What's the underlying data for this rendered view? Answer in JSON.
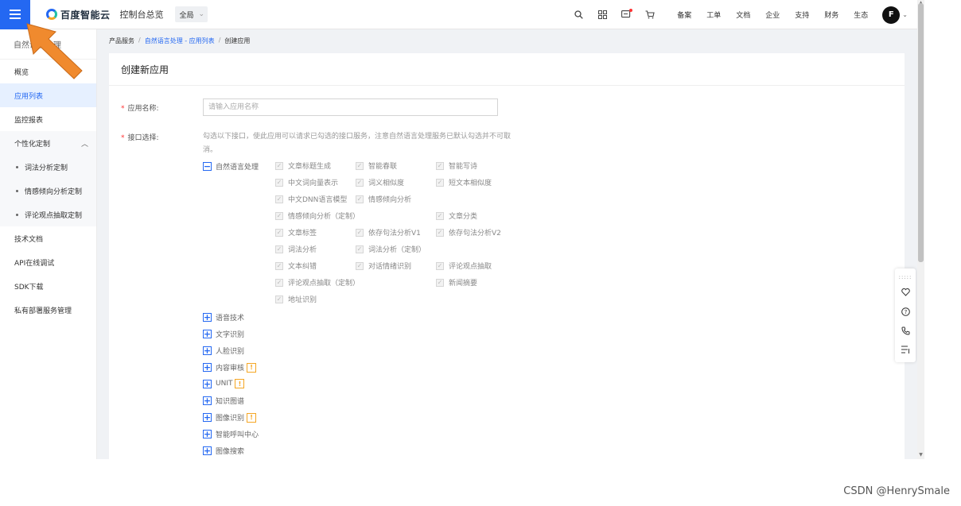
{
  "topbar": {
    "logo_text": "百度智能云",
    "console_label": "控制台总览",
    "region_label": "全局",
    "nav_links": [
      "备案",
      "工单",
      "文档",
      "企业",
      "支持",
      "财务",
      "生态"
    ],
    "avatar_letter": "F"
  },
  "sidebar": {
    "title": "自然语言处理",
    "items": {
      "overview": "概览",
      "app_list": "应用列表",
      "monitor": "监控报表",
      "custom_group": "个性化定制",
      "lexical_custom": "词法分析定制",
      "sentiment_custom": "情感倾向分析定制",
      "opinion_custom": "评论观点抽取定制",
      "tech_docs": "技术文档",
      "api_debug": "API在线调试",
      "sdk": "SDK下载",
      "private_deploy": "私有部署服务管理"
    }
  },
  "breadcrumb": {
    "root": "产品服务",
    "link": "自然语言处理 - 应用列表",
    "current": "创建应用"
  },
  "form": {
    "title": "创建新应用",
    "app_name_label": "应用名称:",
    "app_name_placeholder": "请输入应用名称",
    "api_label": "接口选择:",
    "tip": "勾选以下接口，使此应用可以请求已勾选的接口服务，注意自然语言处理服务已默认勾选并不可取消。",
    "nlp_category": "自然语言处理",
    "nlp_apis": {
      "a1": "文章标题生成",
      "a2": "智能春联",
      "a3": "智能写诗",
      "a4": "中文词向量表示",
      "a5": "词义相似度",
      "a6": "短文本相似度",
      "a7": "中文DNN语言模型",
      "a8": "情感倾向分析",
      "a9": "情感倾向分析（定制）",
      "a10": "文章分类",
      "a11": "文章标签",
      "a12": "依存句法分析V1",
      "a13": "依存句法分析V2",
      "a14": "词法分析",
      "a15": "词法分析（定制）",
      "a16": "文本纠错",
      "a17": "对话情绪识别",
      "a18": "评论观点抽取",
      "a19": "评论观点抽取（定制）",
      "a20": "新闻摘要",
      "a21": "地址识别"
    },
    "other_categories": {
      "c1": "语音技术",
      "c2": "文字识别",
      "c3": "人脸识别",
      "c4": "内容审核",
      "c5": "UNIT",
      "c6": "知识图谱",
      "c7": "图像识别",
      "c8": "智能呼叫中心",
      "c9": "图像搜索"
    },
    "warn_mark": "!"
  },
  "watermark": "CSDN @HenrySmale",
  "colors": {
    "primary": "#2468f2",
    "annotation_arrow": "#f08a2e",
    "warning": "#f5a623"
  }
}
